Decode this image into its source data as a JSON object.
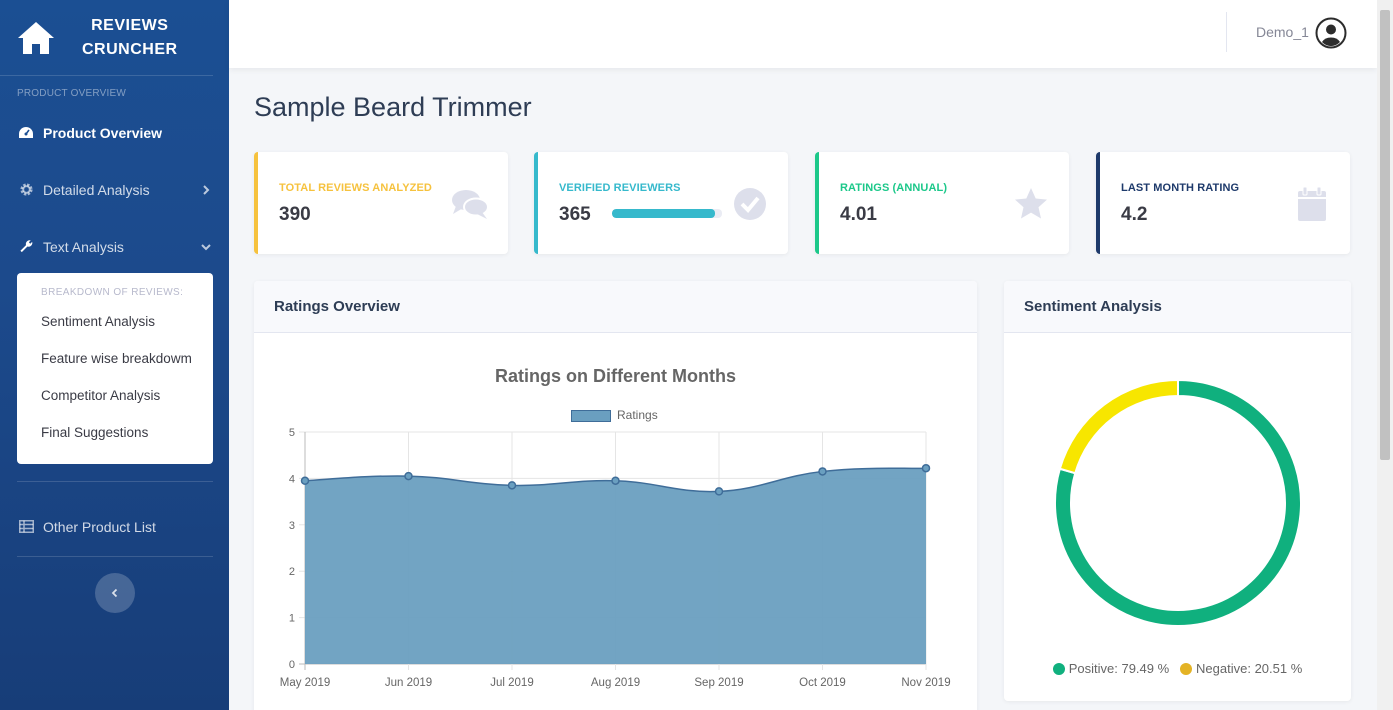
{
  "brand": {
    "line1": "REVIEWS",
    "line2": "CRUNCHER",
    "icon": "home-icon"
  },
  "sidebar": {
    "heading": "PRODUCT OVERVIEW",
    "items": [
      {
        "label": "Product Overview",
        "icon": "dashboard-icon",
        "active": true
      },
      {
        "label": "Detailed Analysis",
        "icon": "gear-icon"
      },
      {
        "label": "Text Analysis",
        "icon": "wrench-icon"
      }
    ],
    "submenu": {
      "heading": "BREAKDOWN OF REVIEWS:",
      "items": [
        "Sentiment Analysis",
        "Feature wise breakdowm",
        "Competitor Analysis",
        "Final Suggestions"
      ]
    },
    "other_item": {
      "label": "Other Product List",
      "icon": "table-icon"
    }
  },
  "topbar": {
    "user_name": "Demo_1"
  },
  "page": {
    "title": "Sample Beard Trimmer"
  },
  "cards": [
    {
      "label": "TOTAL REVIEWS ANALYZED",
      "value": "390",
      "color": "#f6c23e",
      "icon": "comments-icon"
    },
    {
      "label": "VERIFIED REVIEWERS",
      "value": "365",
      "color": "#36b9cc",
      "icon": "check-circle-icon",
      "progress": 0.94
    },
    {
      "label": "RATINGS (ANNUAL)",
      "value": "4.01",
      "color": "#1cc88a",
      "icon": "star-icon"
    },
    {
      "label": "LAST MONTH RATING",
      "value": "4.2",
      "color": "#1e3a6b",
      "icon": "calendar-icon"
    }
  ],
  "ratings_panel": {
    "header": "Ratings Overview"
  },
  "sentiment_panel": {
    "header": "Sentiment Analysis",
    "positive_label": "Positive: 79.49 %",
    "negative_label": "Negative: 20.51 %"
  },
  "chart_data": [
    {
      "type": "area",
      "title": "Ratings on Different Months",
      "categories": [
        "May 2019",
        "Jun 2019",
        "Jul 2019",
        "Aug 2019",
        "Sep 2019",
        "Oct 2019",
        "Nov 2019"
      ],
      "series": [
        {
          "name": "Ratings",
          "values": [
            3.95,
            4.05,
            3.85,
            3.95,
            3.72,
            4.15,
            4.22
          ]
        }
      ],
      "ylim": [
        0,
        5
      ],
      "yticks": [
        "0",
        "1",
        "2",
        "3",
        "4",
        "5"
      ],
      "grid": true,
      "legend": "top",
      "colors": {
        "fill": "#6a9fc0",
        "line": "#3f6d99"
      }
    },
    {
      "type": "pie",
      "categories": [
        "Positive",
        "Negative"
      ],
      "values": [
        79.49,
        20.51
      ],
      "colors": [
        "#10b07e",
        "#f7e600"
      ],
      "legend_colors": [
        "#10b07e",
        "#e4b325"
      ],
      "legend": "bottom"
    }
  ]
}
